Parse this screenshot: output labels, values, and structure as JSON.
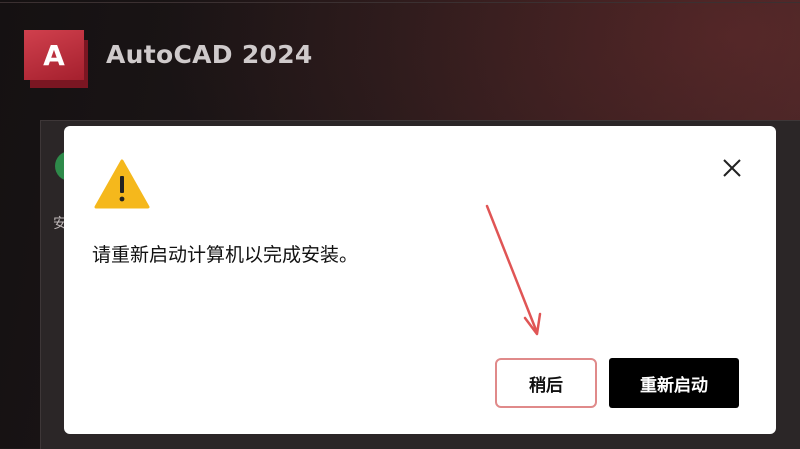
{
  "app": {
    "logo_letter": "A",
    "title": "AutoCAD 2024"
  },
  "installer": {
    "partial_text": "安"
  },
  "dialog": {
    "icon": "warning-icon",
    "message": "请重新启动计算机以完成安装。",
    "close_icon": "close-icon",
    "later_label": "稍后",
    "restart_label": "重新启动"
  },
  "annotation": {
    "type": "arrow",
    "color": "#e05555",
    "points_to": "later-button"
  },
  "colors": {
    "brand": "#c0303e",
    "dialog_bg": "#ffffff",
    "primary_button": "#000000",
    "warning": "#f5b81c"
  }
}
